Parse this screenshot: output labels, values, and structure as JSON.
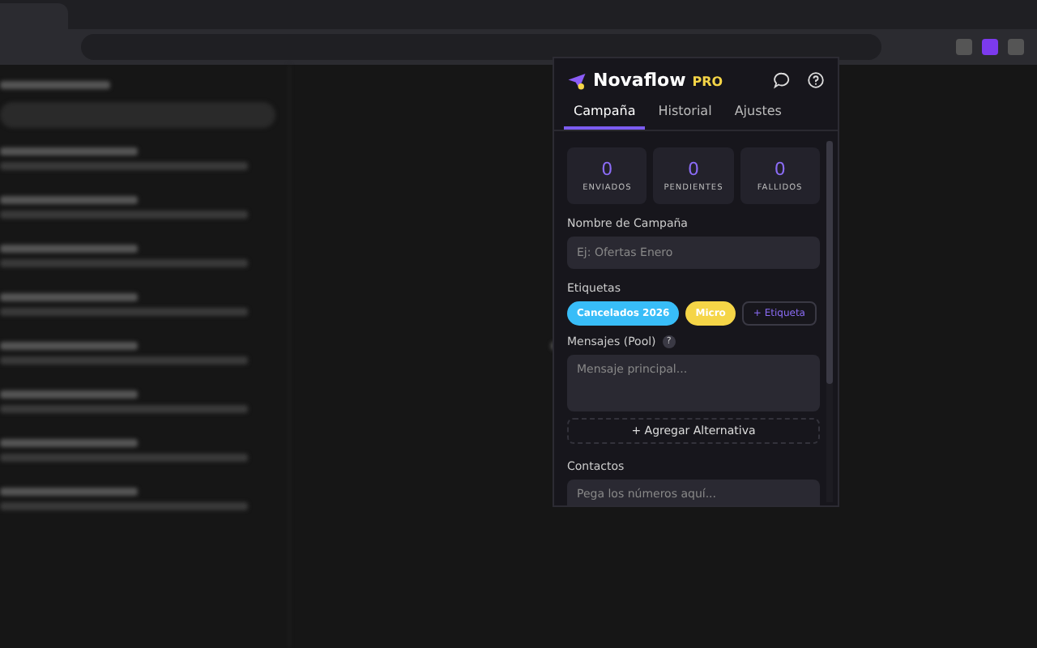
{
  "popup": {
    "brand": "Novaflow",
    "badge": "PRO"
  },
  "tabs": [
    {
      "label": "Campaña",
      "selected": true
    },
    {
      "label": "Historial",
      "selected": false
    },
    {
      "label": "Ajustes",
      "selected": false
    }
  ],
  "stats": [
    {
      "value": "0",
      "label": "ENVIADOS"
    },
    {
      "value": "0",
      "label": "PENDIENTES"
    },
    {
      "value": "0",
      "label": "FALLIDOS"
    }
  ],
  "campaign_name": {
    "label": "Nombre de Campaña",
    "placeholder": "Ej: Ofertas Enero"
  },
  "tags": {
    "label": "Etiquetas",
    "items": [
      {
        "text": "Cancelados 2026",
        "color": "#38bdf8"
      },
      {
        "text": "Micro",
        "color": "#f5d547"
      }
    ],
    "add_button": "+ Etiqueta"
  },
  "messages": {
    "label": "Mensajes (Pool)",
    "help": "?",
    "placeholder": "Mensaje principal...",
    "add_button": "+ Agregar Alternativa"
  },
  "contacts": {
    "label": "Contactos",
    "placeholder": "Pega los números aquí..."
  }
}
